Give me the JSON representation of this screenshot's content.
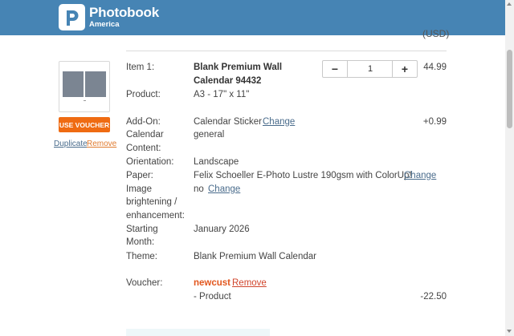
{
  "brand": {
    "name": "Photobook",
    "sub": "America",
    "logo_letter": "p"
  },
  "partial_header": "(USD)",
  "item": {
    "label": "Item 1:",
    "name_line1": "Blank Premium Wall",
    "name_line2": "Calendar 94432",
    "price": "44.99",
    "quantity": "1",
    "minus_label": "−",
    "plus_label": "+"
  },
  "actions": {
    "use_voucher": "USE VOUCHER",
    "duplicate": "Duplicate",
    "remove": "Remove"
  },
  "details": {
    "product_label": "Product:",
    "product_value": "A3 - 17\" x 11\"",
    "addon_label": "Add-On:",
    "addon_value": "Calendar Sticker",
    "addon_change": "Change",
    "addon_price": "+0.99",
    "content_label_1": "Calendar",
    "content_label_2": "Content:",
    "content_value": "general",
    "orientation_label": "Orientation:",
    "orientation_value": "Landscape",
    "paper_label": "Paper:",
    "paper_value": "Felix Schoeller E-Photo Lustre 190gsm with ColorUp!",
    "paper_change": "Change",
    "image_label_1": "Image",
    "image_label_2": "brightening /",
    "image_label_3": "enhancement:",
    "image_value": "no",
    "image_change": "Change",
    "start_label_1": "Starting",
    "start_label_2": "Month:",
    "start_value": "January 2026",
    "theme_label": "Theme:",
    "theme_value": "Blank Premium Wall Calendar"
  },
  "voucher": {
    "label": "Voucher:",
    "code": "newcust",
    "remove": "Remove",
    "line_label": "- Product",
    "line_amount": "-22.50"
  },
  "icons": {
    "logo": "photobook-logo-icon",
    "scroll_up": "arrow-up-icon",
    "scroll_down": "arrow-down-icon"
  },
  "colors": {
    "header": "#4684b4",
    "voucher_button": "#ef6b12",
    "link": "#4a6c8c",
    "voucher_code": "#e2571e"
  }
}
